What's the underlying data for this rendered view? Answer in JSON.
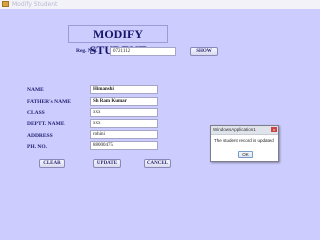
{
  "window": {
    "title": "Modify Student"
  },
  "form": {
    "heading": "MODIFY STUDENT",
    "reg_no": {
      "label": "Reg. NO.",
      "value": "0721112"
    },
    "show_button": "SHOW",
    "fields": [
      {
        "label": "NAME",
        "value": "Himanshi"
      },
      {
        "label": "FATHER's NAME",
        "value": "Sh Ram Kumar"
      },
      {
        "label": "CLASS",
        "value": "xxx"
      },
      {
        "label": "DEPTT. NAME",
        "value": "xxx"
      },
      {
        "label": "ADDRESS",
        "value": "rohini"
      },
      {
        "label": "PH. NO.",
        "value": "88000475"
      }
    ],
    "buttons": {
      "clear": "CLEAR",
      "update": "UPDATE",
      "cancel": "CANCEL"
    }
  },
  "dialog": {
    "title": "WindowsApplication1",
    "close": "x",
    "message": "The student record is updated",
    "ok": "OK"
  }
}
